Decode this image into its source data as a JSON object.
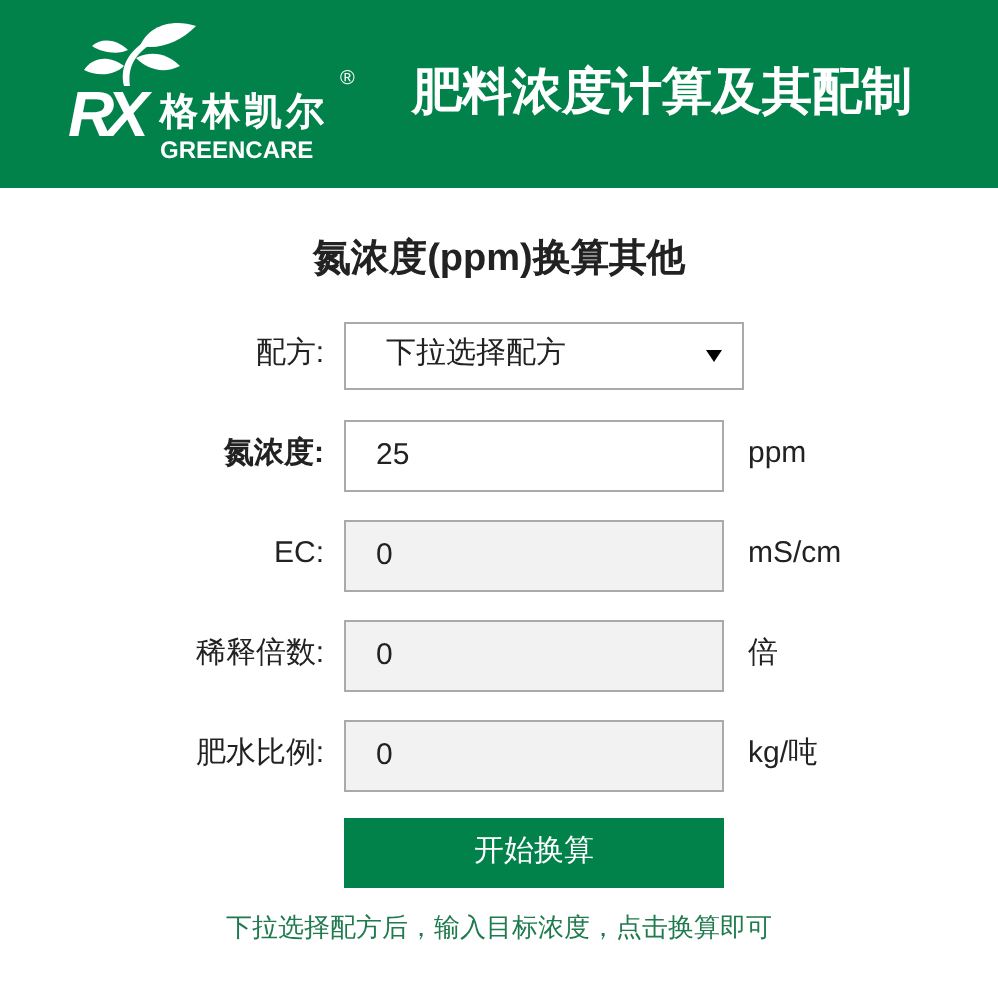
{
  "header": {
    "logo": {
      "mark": "RX",
      "name": "格林凯尔",
      "registered": "®",
      "latin": "GREENCARE"
    },
    "title": "肥料浓度计算及其配制"
  },
  "form": {
    "title": "氮浓度(ppm)换算其他",
    "fields": [
      {
        "kind": "select",
        "label": "配方:",
        "value": "下拉选择配方",
        "emphasized": false,
        "disabled": false
      },
      {
        "kind": "input",
        "label": "氮浓度:",
        "value": "25",
        "unit": "ppm",
        "emphasized": true,
        "disabled": false
      },
      {
        "kind": "input",
        "label": "EC:",
        "value": "0",
        "unit": "mS/cm",
        "emphasized": false,
        "disabled": true
      },
      {
        "kind": "input",
        "label": "稀释倍数:",
        "value": "0",
        "unit": "倍",
        "emphasized": false,
        "disabled": true
      },
      {
        "kind": "input",
        "label": "肥水比例:",
        "value": "0",
        "unit": "kg/吨",
        "emphasized": false,
        "disabled": true
      }
    ],
    "button": "开始换算",
    "hint": "下拉选择配方后，输入目标浓度，点击换算即可"
  }
}
